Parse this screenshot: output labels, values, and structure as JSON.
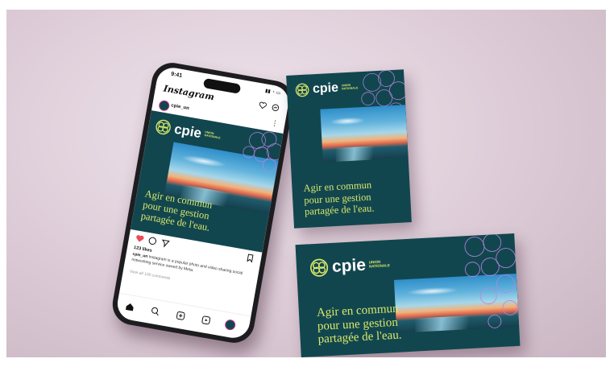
{
  "brand": {
    "name": "cpie",
    "subtitle_line1": "UNION",
    "subtitle_line2": "NATIONALE",
    "headline": [
      "Agir en commun",
      "pour une gestion",
      "partagée de l'eau."
    ]
  },
  "instagram": {
    "status_time": "9:41",
    "app_title": "Instagram",
    "username": "cpie_un",
    "likes": "123 likes",
    "caption_user": "cpie_un",
    "caption_text": "Instagram is a popular photo and video sharing social networking service owned by Meta.",
    "view_comments": "View all 100 comments"
  },
  "colors": {
    "brand_teal": "#12464f",
    "brand_yellow": "#d9e96a",
    "like_red": "#ed4956",
    "background": "#dccbd6"
  },
  "icons": [
    "heart-icon",
    "comment-icon",
    "share-icon",
    "bookmark-icon",
    "home-icon",
    "search-icon",
    "add-icon",
    "reels-icon",
    "profile-icon",
    "messenger-icon"
  ]
}
